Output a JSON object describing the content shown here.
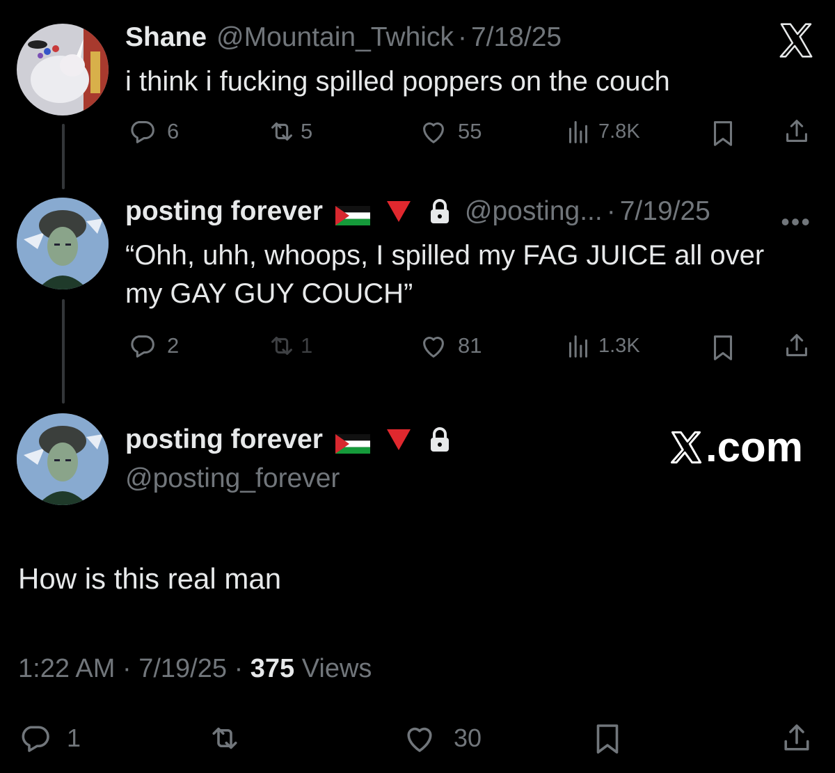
{
  "post1": {
    "name": "Shane",
    "handle": "@Mountain_Twhick",
    "date": "7/18/25",
    "text": "i think i fucking spilled poppers on the couch",
    "replies": "6",
    "reposts": "5",
    "likes": "55",
    "views": "7.8K"
  },
  "post2": {
    "name": "posting forever",
    "handle": "@posting...",
    "date": "7/19/25",
    "text": "“Ohh, uhh, whoops, I spilled my FAG JUICE all over my GAY GUY COUCH”",
    "replies": "2",
    "reposts": "1",
    "likes": "81",
    "views": "1.3K"
  },
  "main": {
    "name": "posting forever",
    "handle": "@posting_forever",
    "site": ".com",
    "text": "How is this real man",
    "time": "1:22 AM",
    "date": "7/19/25",
    "views_count": "375",
    "views_label": "Views",
    "replies": "1",
    "likes": "30"
  },
  "icons": {
    "reply": "reply-icon",
    "repost": "repost-icon",
    "like": "heart-icon",
    "views": "views-icon",
    "bookmark": "bookmark-icon",
    "share": "share-icon"
  },
  "colors": {
    "background": "#000000",
    "text": "#e7e9ea",
    "muted": "#71767b",
    "red_triangle": "#e0282e"
  }
}
